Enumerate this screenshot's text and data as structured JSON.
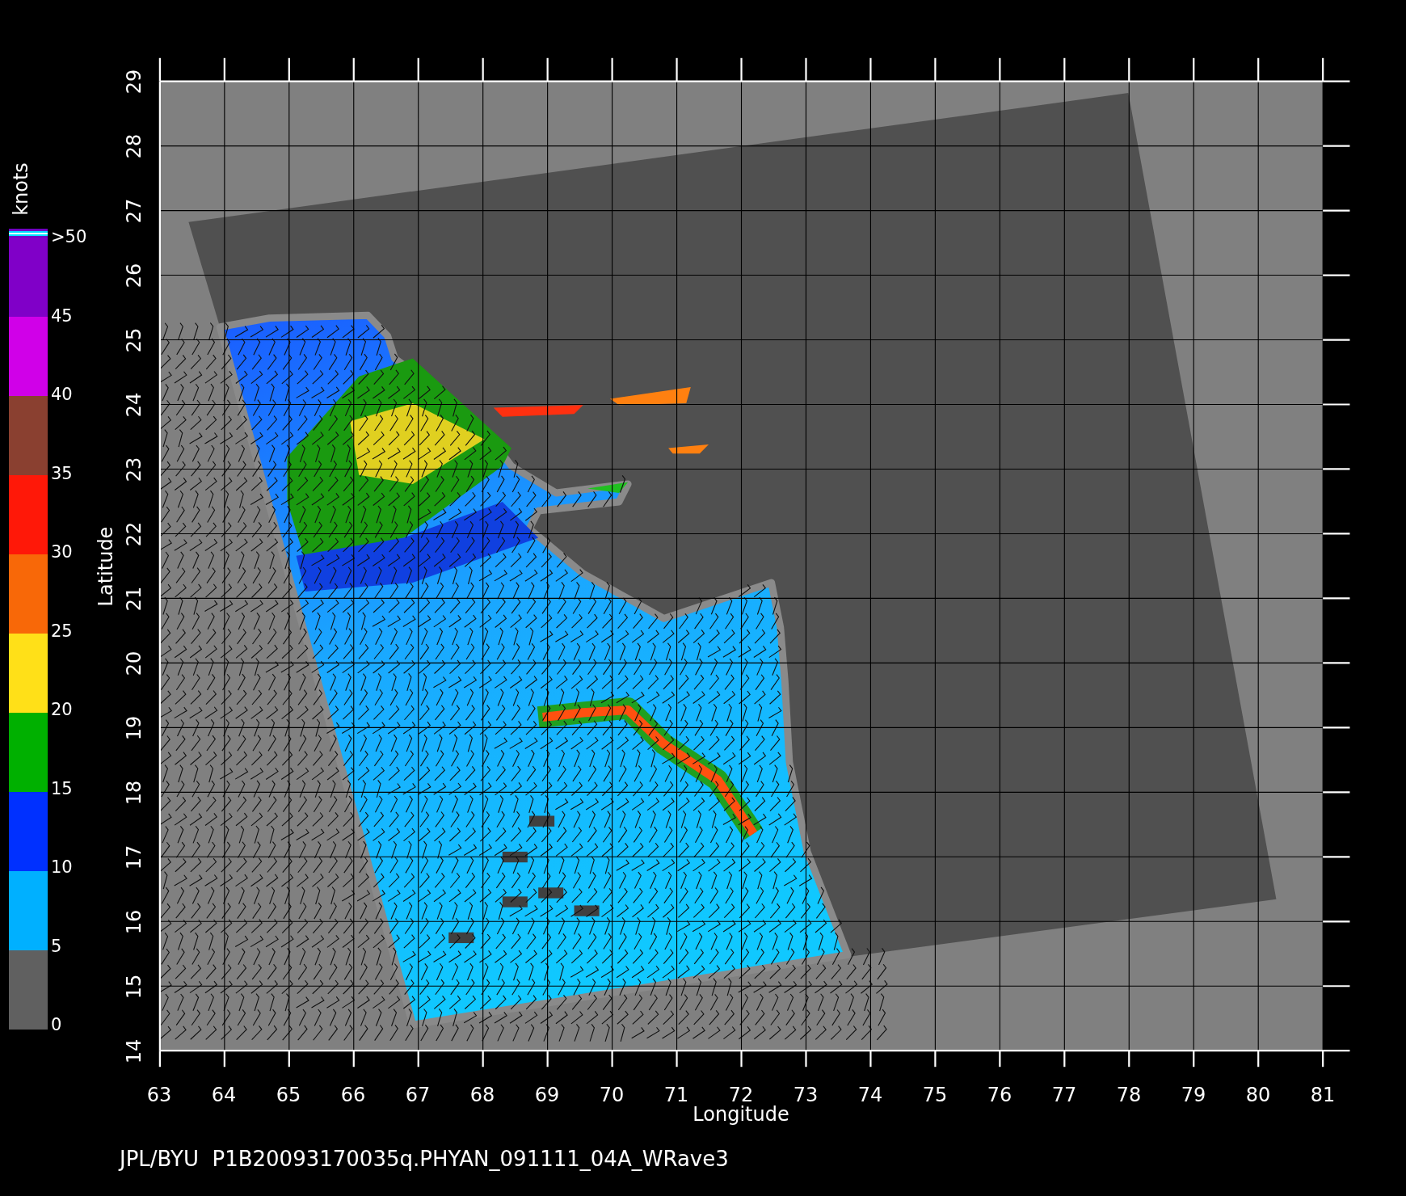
{
  "colorbar": {
    "unit": "knots",
    "segments": [
      {
        "color": "#8000c8"
      },
      {
        "color": "#d000e8"
      },
      {
        "color": "#8a4030"
      },
      {
        "color": "#ff1808"
      },
      {
        "color": "#f86808"
      },
      {
        "color": "#ffe018"
      },
      {
        "color": "#00b000"
      },
      {
        "color": "#0030ff"
      },
      {
        "color": "#00b0ff"
      },
      {
        "color": "#606060"
      }
    ],
    "labels": [
      ">50",
      "45",
      "40",
      "35",
      "30",
      "25",
      "20",
      "15",
      "10",
      "5",
      "0"
    ]
  },
  "map": {
    "latitude_label": "Latitude",
    "longitude_label": "Longitude",
    "latitude_ticks": [
      "29",
      "28",
      "27",
      "26",
      "25",
      "24",
      "23",
      "22",
      "21",
      "20",
      "19",
      "18",
      "17",
      "16",
      "15",
      "14"
    ],
    "longitude_ticks": [
      "63",
      "64",
      "65",
      "66",
      "67",
      "68",
      "69",
      "70",
      "71",
      "72",
      "73",
      "74",
      "75",
      "76",
      "77",
      "78",
      "79",
      "80",
      "81"
    ]
  },
  "footer": "JPL/BYU  P1B20093170035q.PHYAN_091111_04A_WRave3"
}
